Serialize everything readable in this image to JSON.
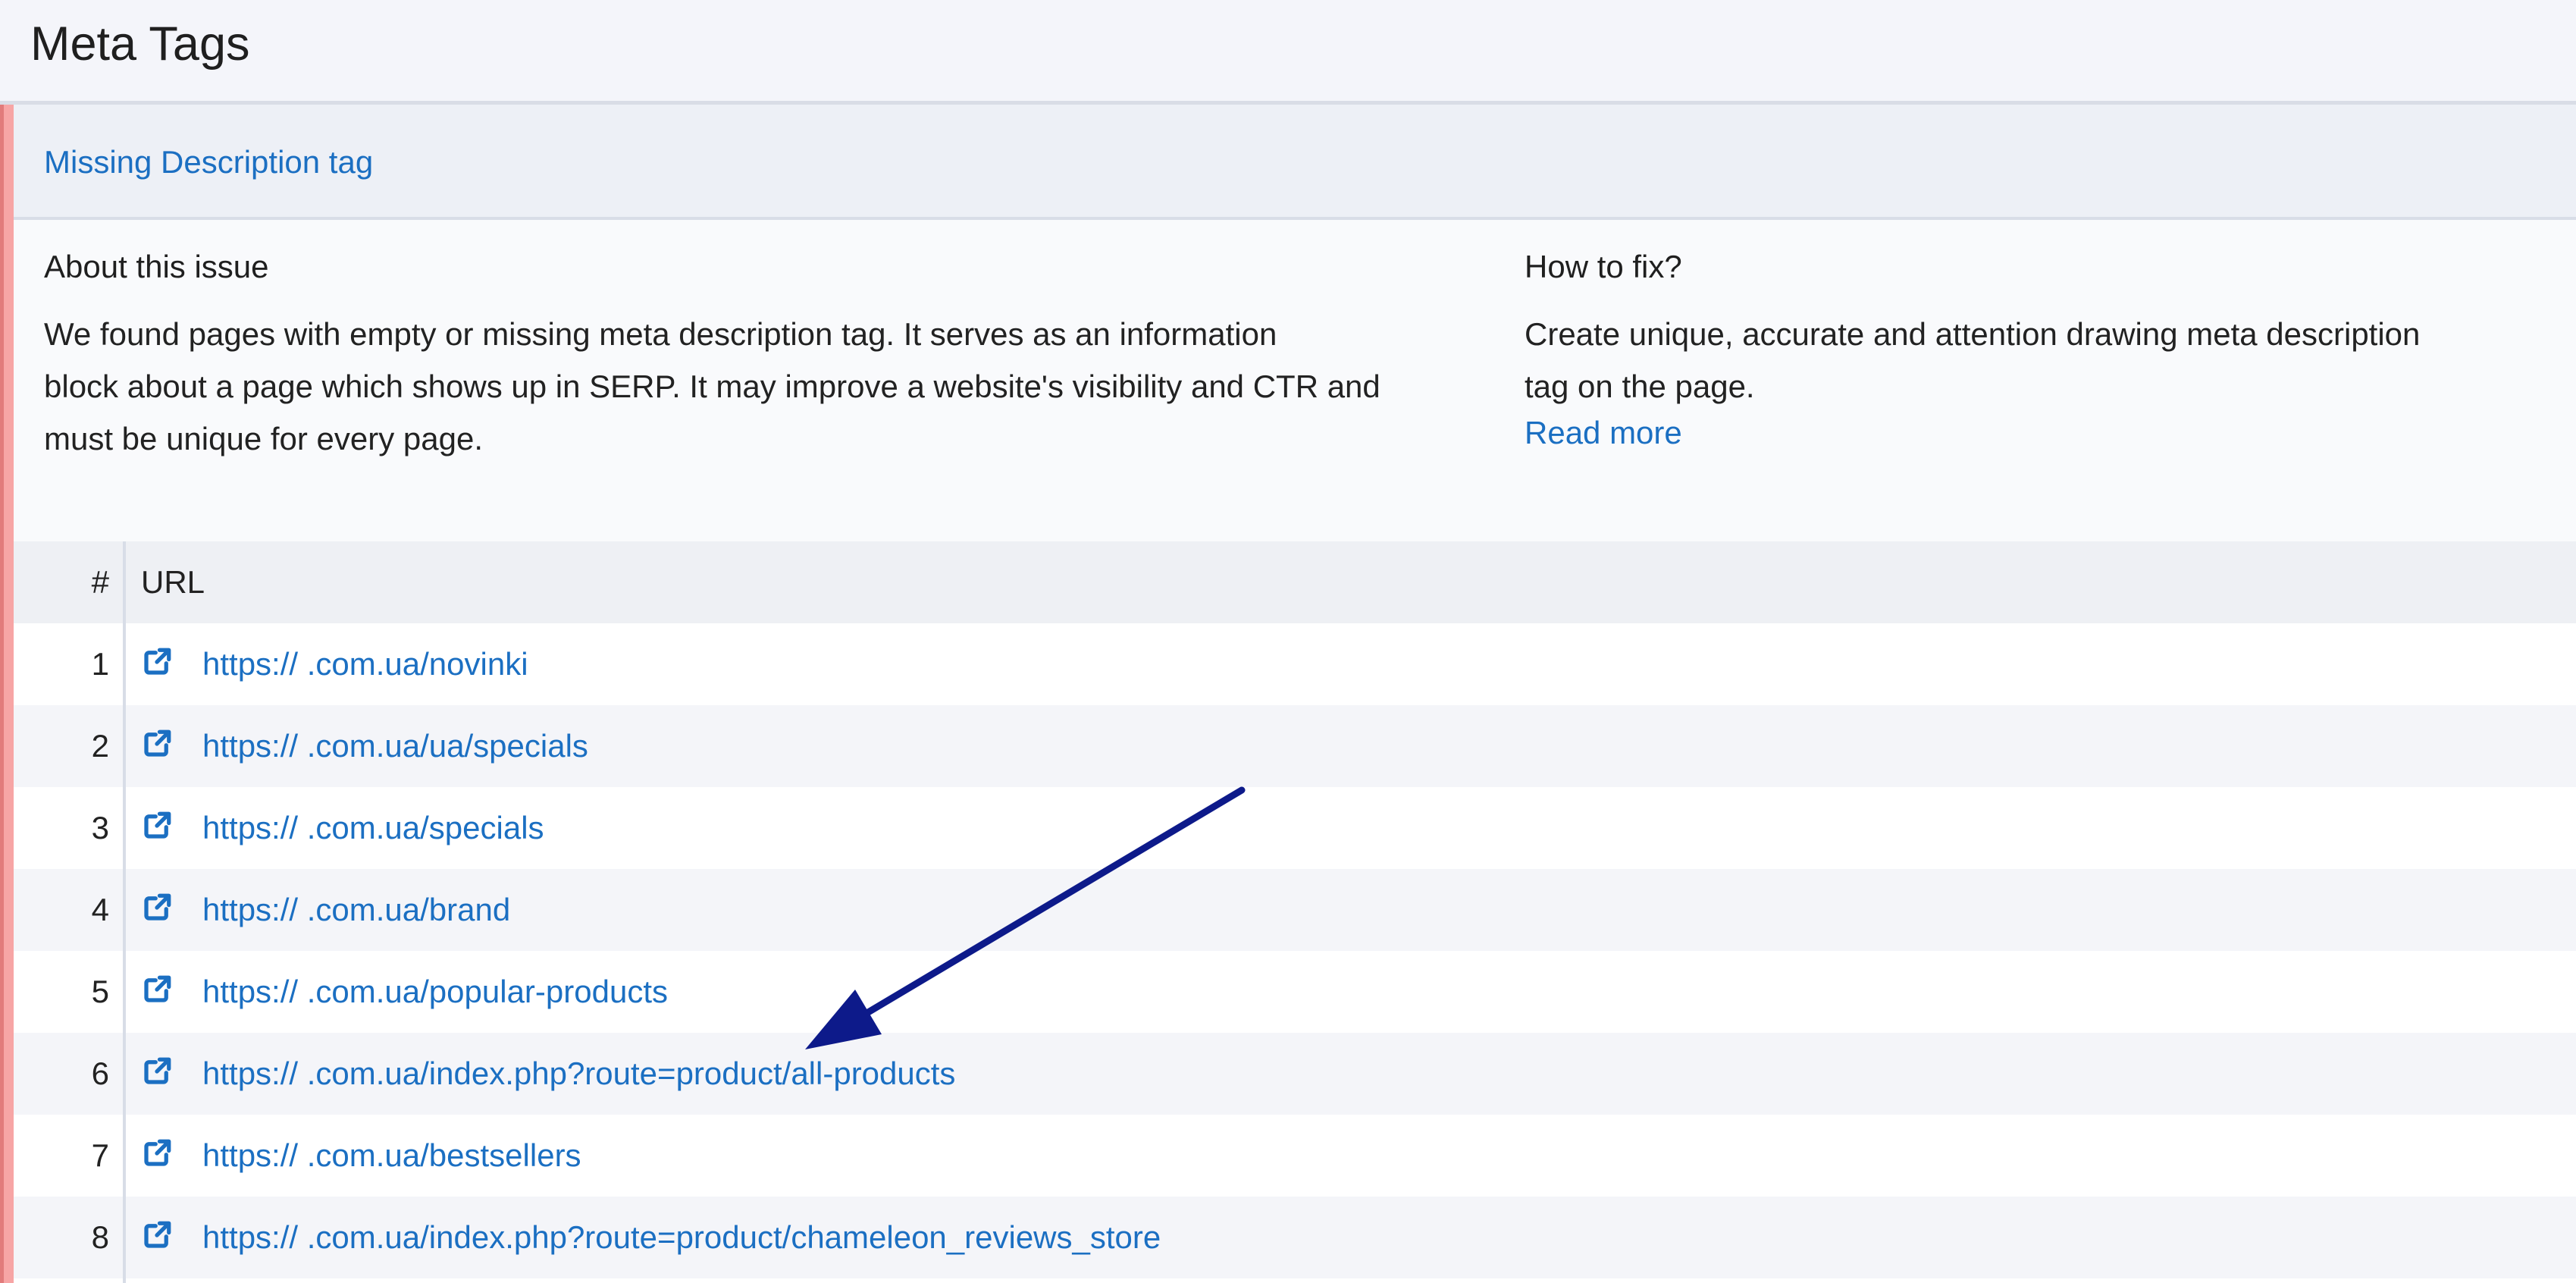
{
  "page": {
    "title": "Meta Tags"
  },
  "issue": {
    "title": "Missing Description tag",
    "about": {
      "heading": "About this issue",
      "lines": [
        "We found pages with empty or missing meta description tag. It serves as an information",
        "block about a page which shows up in SERP. It may improve a website's visibility and CTR and",
        "must be unique for every page."
      ]
    },
    "fix": {
      "heading": "How to fix?",
      "lines": [
        "Create unique, accurate and attention drawing meta description",
        "tag on the page."
      ],
      "read_more": "Read more"
    }
  },
  "table": {
    "headers": {
      "num": "#",
      "url": "URL"
    },
    "rows": [
      {
        "num": "1",
        "url": "https://         .com.ua/novinki"
      },
      {
        "num": "2",
        "url": "https://         .com.ua/ua/specials"
      },
      {
        "num": "3",
        "url": "https://         .com.ua/specials"
      },
      {
        "num": "4",
        "url": "https://         .com.ua/brand"
      },
      {
        "num": "5",
        "url": "https://         .com.ua/popular-products"
      },
      {
        "num": "6",
        "url": "https://         .com.ua/index.php?route=product/all-products"
      },
      {
        "num": "7",
        "url": "https://         .com.ua/bestsellers"
      },
      {
        "num": "8",
        "url": "https://         .com.ua/index.php?route=product/chameleon_reviews_store"
      }
    ]
  },
  "icons": {
    "external_link": "external-link-icon",
    "annotation": "arrow-annotation"
  },
  "colors": {
    "link": "#1b6fc2",
    "accent_error": "#f7a5a5",
    "annotation_arrow": "#0d1a8a"
  }
}
